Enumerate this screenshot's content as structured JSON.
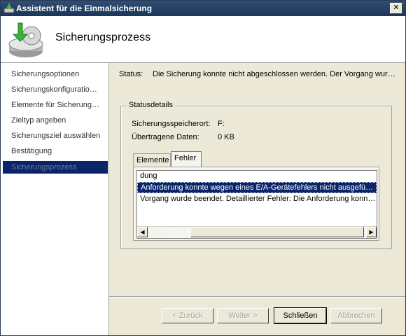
{
  "window": {
    "title": "Assistent für die Einmalsicherung",
    "close_label": "✕"
  },
  "header": {
    "heading": "Sicherungsprozess",
    "icon": "backup-disk-icon"
  },
  "sidebar": {
    "items": [
      {
        "label": "Sicherungsoptionen"
      },
      {
        "label": "Sicherungskonfiguratio…"
      },
      {
        "label": "Elemente für Sicherung…"
      },
      {
        "label": "Zieltyp angeben"
      },
      {
        "label": "Sicherungsziel auswählen"
      },
      {
        "label": "Bestätigung"
      },
      {
        "label": "Sicherungsprozess"
      }
    ],
    "active_index": 6
  },
  "status": {
    "label": "Status:",
    "text": "Die Sicherung konnte nicht abgeschlossen werden. Der Vorgang wur…"
  },
  "details": {
    "legend": "Statusdetails",
    "location_label": "Sicherungsspeicherort:",
    "location_value": "F:",
    "transferred_label": "Übertragene Daten:",
    "transferred_value": "0 KB"
  },
  "tabs": [
    {
      "label": "Elemente"
    },
    {
      "label": "Fehler"
    }
  ],
  "selected_tab": "Fehler",
  "errors": {
    "items": [
      "dung",
      "Anforderung konnte wegen eines E/A-Gerätefehlers nicht ausgeführ…",
      "Vorgang wurde beendet. Detaillierter Fehler: Die Anforderung konnt…"
    ],
    "selected_index": 1
  },
  "buttons": {
    "back": "< Zurück",
    "next": "Weiter >",
    "close": "Schließen",
    "cancel": "Abbrechen"
  },
  "colors": {
    "titlebar": "#1c3557",
    "selection": "#0a246a",
    "panel": "#ece9d8"
  }
}
